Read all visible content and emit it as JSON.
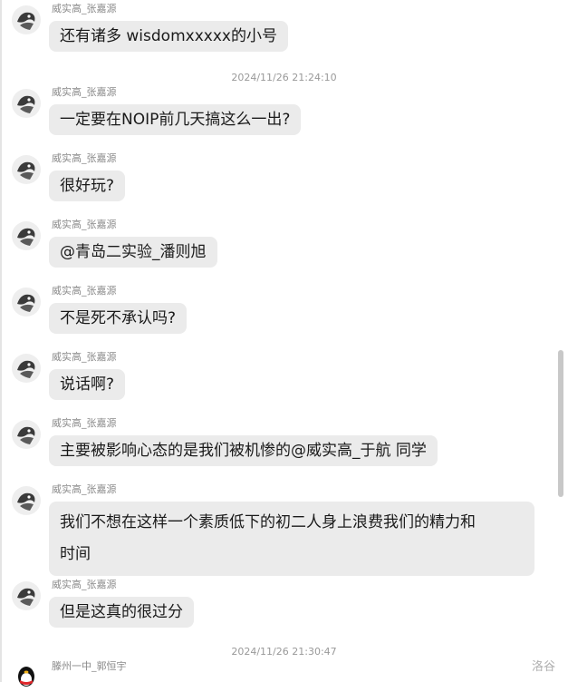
{
  "messages": [
    {
      "sender": "威实高_张嘉源",
      "text": "还有诸多 wisdomxxxxx的小号"
    },
    {
      "sender": "威实高_张嘉源",
      "text": "一定要在NOIP前几天搞这么一出?"
    },
    {
      "sender": "威实高_张嘉源",
      "text": "很好玩?"
    },
    {
      "sender": "威实高_张嘉源",
      "text": "@青岛二实验_潘则旭"
    },
    {
      "sender": "威实高_张嘉源",
      "text": "不是死不承认吗?"
    },
    {
      "sender": "威实高_张嘉源",
      "text": "说话啊?"
    },
    {
      "sender": "威实高_张嘉源",
      "text": "主要被影响心态的是我们被机惨的@威实高_于航 同学"
    },
    {
      "sender": "威实高_张嘉源",
      "text_line1": "我们不想在这样一个素质低下的初二人身上浪费我们的精力和",
      "text_line2": "时间"
    },
    {
      "sender": "威实高_张嘉源",
      "text": "但是这真的很过分"
    },
    {
      "sender": "滕州一中_郭恒宇"
    }
  ],
  "timestamps": [
    "2024/11/26 21:24:10",
    "2024/11/26 21:30:47"
  ],
  "watermark": "洛谷",
  "colors": {
    "bubble": "#ebebeb",
    "meta_text": "#8a8a8a",
    "background": "#ffffff"
  },
  "icons": {
    "avatar": "penguin-avatar-icon",
    "qq_avatar": "qq-penguin-icon"
  }
}
